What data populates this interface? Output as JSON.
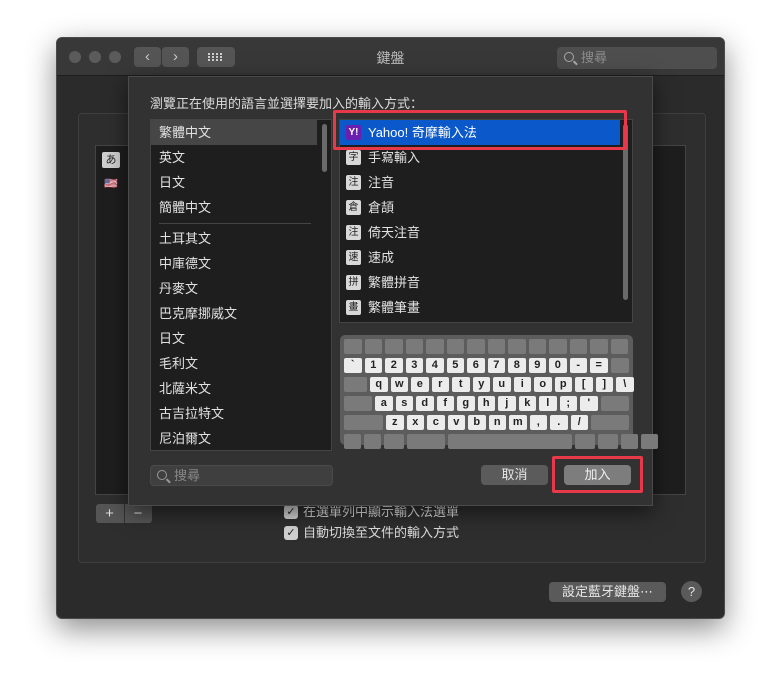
{
  "window": {
    "title": "鍵盤",
    "search_placeholder": "搜尋",
    "nav_back": "‹",
    "nav_forward": "›"
  },
  "source_list": {
    "items": [
      {
        "icon": "あ",
        "icon_name": "japanese-input-icon"
      },
      {
        "icon": "🇺🇸",
        "icon_name": "us-flag-icon"
      }
    ],
    "add_label": "+",
    "remove_label": "−"
  },
  "options": {
    "show_menu_label": "在選單列中顯示輸入法選單",
    "show_menu_checked": true,
    "auto_switch_label": "自動切換至文件的輸入方式",
    "auto_switch_checked": true,
    "check_mark": "✓"
  },
  "bluetooth_button": "設定藍牙鍵盤⋯",
  "help_button": "?",
  "sheet": {
    "title": "瀏覽正在使用的語言並選擇要加入的輸入方式：",
    "languages": [
      "繁體中文",
      "英文",
      "日文",
      "簡體中文",
      "土耳其文",
      "中庫德文",
      "丹麥文",
      "巴克摩挪威文",
      "日文",
      "毛利文",
      "北薩米文",
      "古吉拉特文",
      "尼泊爾文"
    ],
    "selected_language": "繁體中文",
    "methods": [
      {
        "icon": "Y!",
        "icon_name": "yahoo-icon",
        "label": "Yahoo! 奇摩輸入法"
      },
      {
        "icon": "字",
        "icon_name": "handwriting-icon",
        "label": "手寫輸入"
      },
      {
        "icon": "注",
        "icon_name": "zhuyin-icon",
        "label": "注音"
      },
      {
        "icon": "倉",
        "icon_name": "cangjie-icon",
        "label": "倉頡"
      },
      {
        "icon": "注",
        "icon_name": "eten-zhuyin-icon",
        "label": "倚天注音"
      },
      {
        "icon": "速",
        "icon_name": "sucheng-icon",
        "label": "速成"
      },
      {
        "icon": "拼",
        "icon_name": "pinyin-icon",
        "label": "繁體拼音"
      },
      {
        "icon": "畫",
        "icon_name": "stroke-icon",
        "label": "繁體筆畫"
      }
    ],
    "selected_method": "Yahoo! 奇摩輸入法",
    "keyboard_rows": [
      [
        "`",
        "1",
        "2",
        "3",
        "4",
        "5",
        "6",
        "7",
        "8",
        "9",
        "0",
        "-",
        "="
      ],
      [
        "q",
        "w",
        "e",
        "r",
        "t",
        "y",
        "u",
        "i",
        "o",
        "p",
        "[",
        "]",
        "\\"
      ],
      [
        "a",
        "s",
        "d",
        "f",
        "g",
        "h",
        "j",
        "k",
        "l",
        ";",
        "'"
      ],
      [
        "z",
        "x",
        "c",
        "v",
        "b",
        "n",
        "m",
        ",",
        ".",
        "/"
      ]
    ],
    "search_placeholder": "搜尋",
    "cancel_label": "取消",
    "add_label": "加入"
  },
  "colors": {
    "selection": "#0a58c9",
    "highlight": "#e8394a",
    "window_bg": "#2b2b2b"
  }
}
